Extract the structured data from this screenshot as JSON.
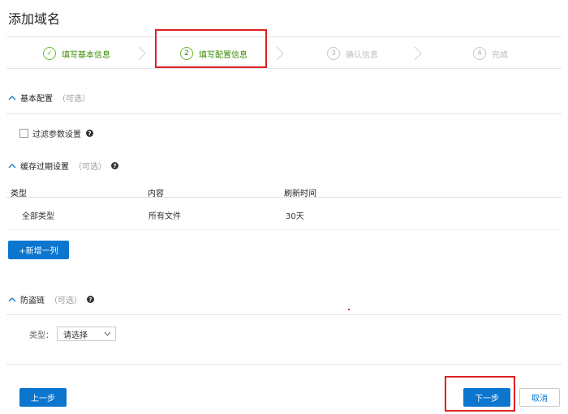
{
  "page": {
    "title": "添加域名"
  },
  "steps": [
    {
      "num": "✓",
      "label": "填写基本信息"
    },
    {
      "num": "2",
      "label": "填写配置信息"
    },
    {
      "num": "3",
      "label": "确认信息"
    },
    {
      "num": "4",
      "label": "完成"
    }
  ],
  "basic": {
    "title": "基本配置",
    "optional": "（可选）",
    "filter_label": "过滤参数设置"
  },
  "cache": {
    "title": "缓存过期设置",
    "optional": "（可选）",
    "columns": [
      "类型",
      "内容",
      "刷新时间"
    ],
    "rows": [
      {
        "type": "全部类型",
        "content": "所有文件",
        "refresh": "30天"
      }
    ],
    "add_label": "+新增一列"
  },
  "hotlink": {
    "title": "防盗链",
    "optional": "（可选）",
    "type_label": "类型：",
    "select_value": "请选择"
  },
  "footer": {
    "prev_label": "上一步",
    "next_label": "下一步",
    "cancel_label": "取消"
  },
  "colors": {
    "primary": "#0c76cf",
    "step_green": "#6aba2a",
    "highlight": "#e02020"
  }
}
